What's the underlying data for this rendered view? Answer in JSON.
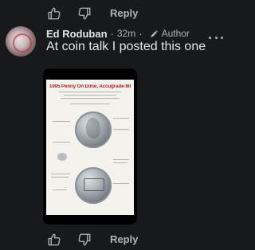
{
  "top_actions": {
    "like_icon": "thumbs-up-icon",
    "dislike_icon": "thumbs-down-icon",
    "reply_label": "Reply"
  },
  "comment": {
    "author": "Ed Roduban",
    "separator": "·",
    "time": "32m",
    "separator2": "·",
    "badge_icon": "pencil-icon",
    "badge_label": "Author",
    "more_icon": "more-horizontal-icon",
    "text": "At coin talk I posted this one",
    "attachment": {
      "title": "1995 Penny On Dime, Accugrade-MINT"
    }
  },
  "bottom_actions": {
    "like_icon": "thumbs-up-icon",
    "dislike_icon": "thumbs-down-icon",
    "reply_label": "Reply"
  },
  "colors": {
    "background": "#18191a",
    "text_primary": "#e4e6eb",
    "text_secondary": "#b0b3b8"
  }
}
